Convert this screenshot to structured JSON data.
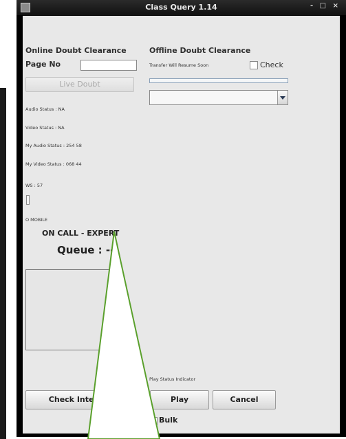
{
  "window": {
    "title": "Class Query 1.14",
    "controls": "- □ ×"
  },
  "online": {
    "heading": "Online Doubt Clearance",
    "page_no_label": "Page No",
    "page_no_value": "",
    "live_doubt_button": "Live Doubt"
  },
  "offline": {
    "heading": "Offline Doubt Clearance",
    "transfer_text": "Transfer Will Resume Soon",
    "check_label": "Check",
    "check_checked": false,
    "dropdown_value": ""
  },
  "status": {
    "audio": "Audio Status : NA",
    "video": "Video Status : NA",
    "my_audio": "My Audio Status : 254 58",
    "my_video": "My Video Status : 068 44",
    "ws": "WS : 57",
    "mobile": "O MOBILE"
  },
  "call": {
    "state": "ON CALL - EXPERT",
    "queue": "Queue : --"
  },
  "play": {
    "status_label": "Play Status Indicator",
    "play_button": "Play",
    "cancel_button": "Cancel",
    "bulk_label": "Bulk",
    "bulk_checked": true
  },
  "footer": {
    "check_internet_button": "Check Interne"
  },
  "colors": {
    "callout_stroke": "#5aa02c",
    "title_bar": "#1a1a1a",
    "panel": "#e8e8e8"
  }
}
